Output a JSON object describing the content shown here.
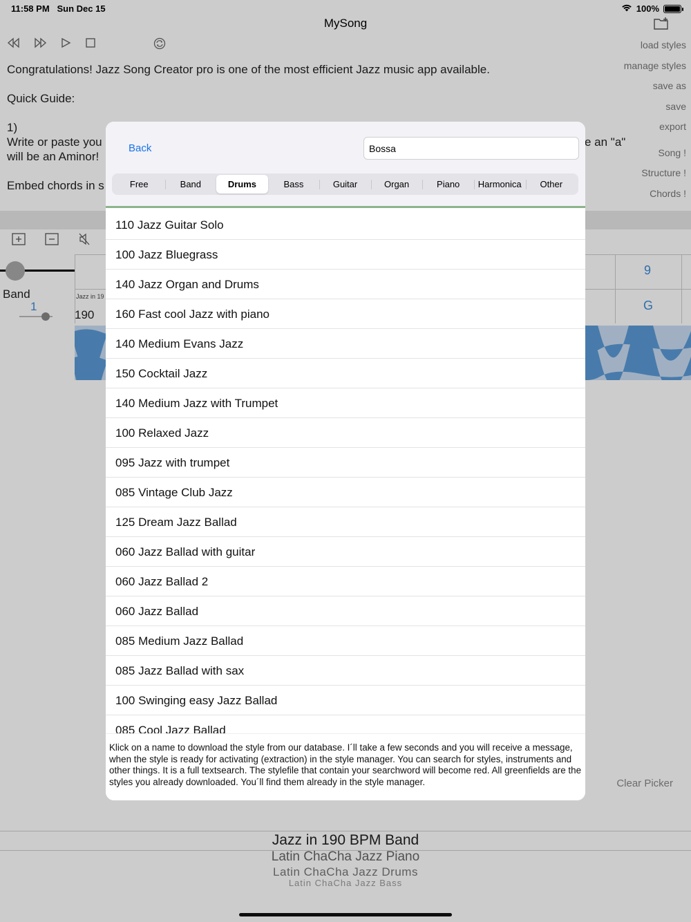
{
  "status": {
    "time": "11:58 PM",
    "date": "Sun Dec 15",
    "battery": "100%",
    "battery_level": 1.0
  },
  "nav": {
    "title": "MySong",
    "folder_icon": "folder-add-icon"
  },
  "toolbar": {
    "icons": [
      "rewind-icon",
      "fast-forward-icon",
      "play-icon",
      "stop-icon",
      "loop-icon"
    ]
  },
  "side_links": [
    "load styles",
    "manage styles",
    "save as",
    "save",
    "export",
    "Song !",
    "Structure !",
    "Chords !"
  ],
  "intro": {
    "line1": "Congratulations! Jazz Song Creator pro is one of the most efficient Jazz music app available.",
    "line2": "Quick Guide:",
    "line3": "1)",
    "line4_left": "Write or paste you",
    "line4_right": "e an \"a\"",
    "line5": "will be an Aminor!",
    "line6": "Embed chords in s"
  },
  "track": {
    "band_label": "Band",
    "band_value": "1",
    "cell_small": "Jazz in 19",
    "cell_tempo": "190",
    "cell_bar": "9",
    "cell_chord": "G",
    "icons": [
      "add-track-icon",
      "remove-track-icon",
      "mute-icon"
    ]
  },
  "modal": {
    "back_label": "Back",
    "search_value": "Bossa",
    "tabs": [
      "Free",
      "Band",
      "Drums",
      "Bass",
      "Guitar",
      "Organ",
      "Piano",
      "Harmonica",
      "Other"
    ],
    "active_tab": "Drums",
    "styles": [
      "110 Jazz Guitar Solo",
      "100 Jazz Bluegrass",
      "140 Jazz Organ and Drums",
      "160 Fast cool Jazz with piano",
      "140 Medium Evans Jazz",
      "150 Cocktail Jazz",
      "140 Medium Jazz with Trumpet",
      "100 Relaxed Jazz",
      "095 Jazz with trumpet",
      "085 Vintage Club Jazz",
      "125 Dream Jazz Ballad",
      "060 Jazz Ballad with guitar",
      "060 Jazz Ballad 2",
      "060 Jazz Ballad",
      "085 Medium Jazz Ballad",
      "085 Jazz Ballad with sax",
      "100 Swinging easy Jazz Ballad",
      "085 Cool Jazz Ballad"
    ],
    "help_text": "Klick on a name to download the style from our database.  I´ll take a few seconds and you will receive a message, when the style is ready for activating (extraction) in the style manager. You can search for styles, instruments and other things. It is a full textsearch. The stylefile that contain your searchword will become red. All greenfields are the styles you already downloaded. You´ll find them already in the style manager."
  },
  "clear_picker": "Clear Picker",
  "picker": {
    "selected": "Jazz in 190 BPM Band",
    "items": [
      "Latin ChaCha Jazz Piano",
      "Latin ChaCha Jazz Drums",
      "Latin ChaCha Jazz Bass"
    ]
  }
}
